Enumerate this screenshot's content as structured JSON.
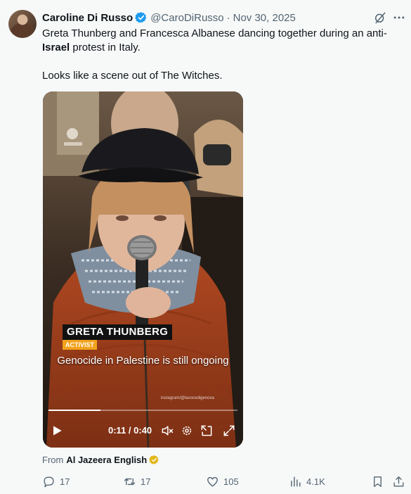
{
  "tweet": {
    "author_name": "Caroline Di Russo",
    "handle": "@CaroDiRusso",
    "separator": "·",
    "date": "Nov 30, 2025",
    "text_line1_part1": "Greta Thunberg and Francesca Albanese dancing together during an anti-",
    "text_hashtag": "Israel",
    "text_line1_part2": " protest in Italy.",
    "text_line2": "Looks like a scene out of The Witches."
  },
  "video": {
    "lower_third_name": "GRETA THUNBERG",
    "lower_third_role": "ACTIVIST",
    "subtitle": "Genocide in Palestine is still ongoing",
    "credit": "instagram/@lavocedigenova",
    "time": "0:11 / 0:40",
    "progress_fraction": 0.275
  },
  "source": {
    "prefix": "From",
    "name": "Al Jazeera English"
  },
  "actions": {
    "replies": "17",
    "reposts": "17",
    "likes": "105",
    "views": "4.1K"
  },
  "icons": [
    "verified-badge-icon",
    "grok-icon",
    "more-icon",
    "play-icon",
    "mute-icon",
    "settings-icon",
    "pip-icon",
    "fullscreen-icon",
    "reply-icon",
    "repost-icon",
    "like-icon",
    "views-icon",
    "bookmark-icon",
    "share-icon"
  ],
  "colors": {
    "verified_blue": "#1d9bf0",
    "gold_badge": "#e2b719",
    "muted_text": "#536471",
    "background": "#f7f9f9"
  }
}
